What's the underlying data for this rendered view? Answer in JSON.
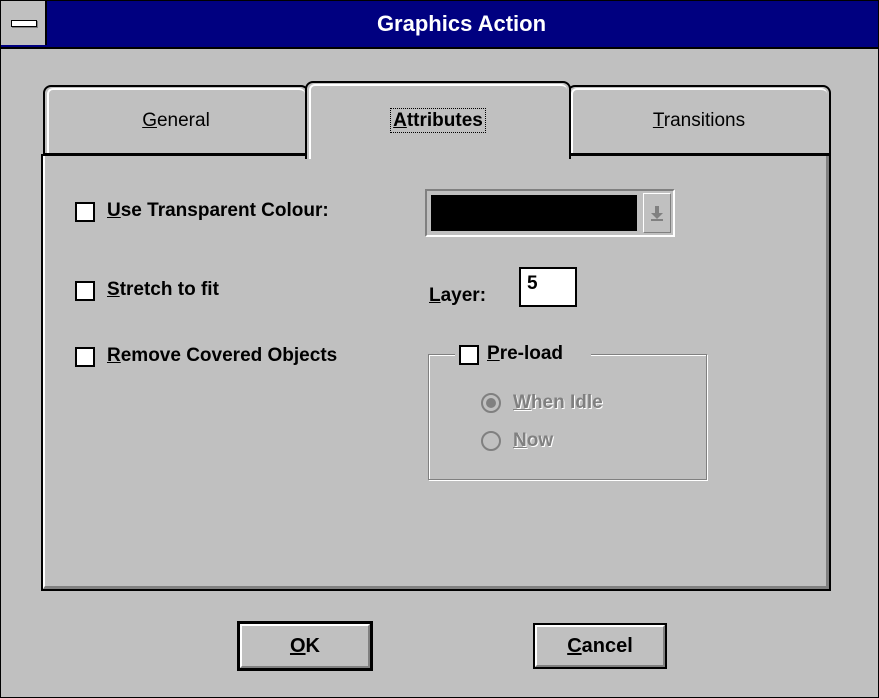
{
  "window": {
    "title": "Graphics Action"
  },
  "tabs": [
    {
      "label": "General",
      "mnemonic": "G",
      "rest": "eneral",
      "selected": false
    },
    {
      "label": "Attributes",
      "mnemonic": "A",
      "rest": "ttributes",
      "selected": true
    },
    {
      "label": "Transitions",
      "mnemonic": "T",
      "rest": "ransitions",
      "selected": false
    }
  ],
  "attributes": {
    "use_transparent": {
      "label": "Use Transparent Colour:",
      "mnemonic": "U",
      "rest": "se Transparent Colour:",
      "checked": false
    },
    "colour": {
      "value": "#000000"
    },
    "stretch": {
      "label": "Stretch to fit",
      "mnemonic": "S",
      "rest": "tretch to fit",
      "checked": false
    },
    "layer": {
      "label": "Layer:",
      "mnemonic": "L",
      "rest": "ayer:",
      "value": "5"
    },
    "remove_covered": {
      "label": "Remove Covered Objects",
      "mnemonic": "R",
      "rest": "emove Covered Objects",
      "checked": false
    },
    "preload": {
      "label": "Pre-load",
      "mnemonic": "P",
      "rest": "re-load",
      "checked": false,
      "options": [
        {
          "label": "When Idle",
          "mnemonic": "W",
          "rest": "hen Idle",
          "selected": true,
          "enabled": false
        },
        {
          "label": "Now",
          "mnemonic": "N",
          "rest": "ow",
          "selected": false,
          "enabled": false
        }
      ]
    }
  },
  "buttons": {
    "ok": {
      "label": "OK",
      "mnemonic": "O",
      "rest": "K"
    },
    "cancel": {
      "label": "Cancel",
      "mnemonic": "C",
      "rest": "ancel"
    }
  },
  "colors": {
    "titlebar": "#000080",
    "face": "#c0c0c0",
    "disabled": "#808080"
  }
}
